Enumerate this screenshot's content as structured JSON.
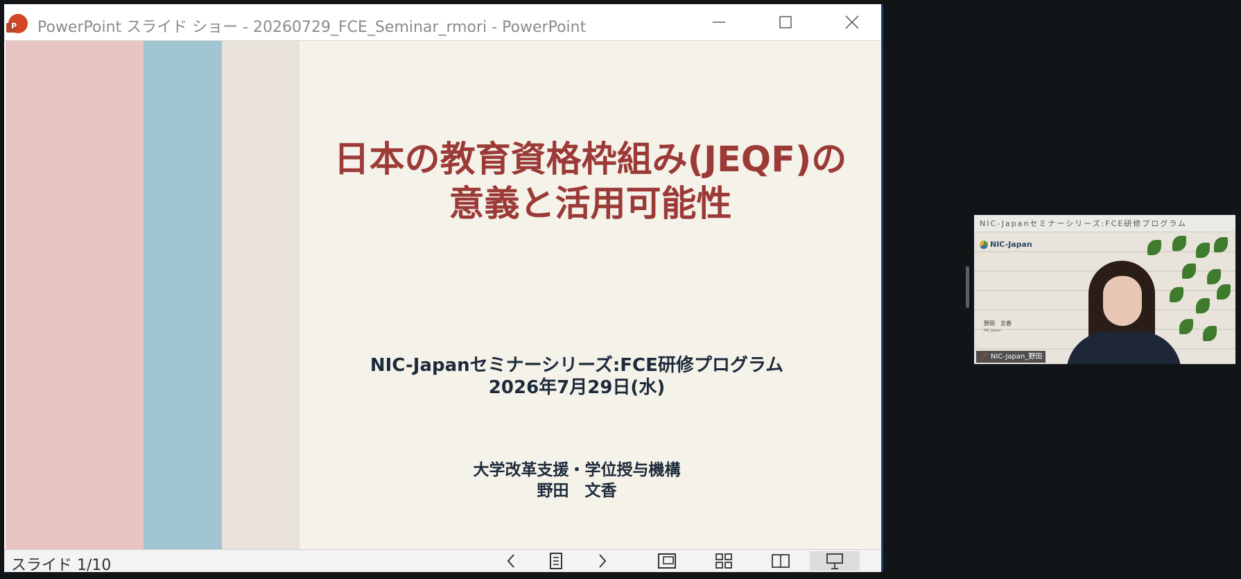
{
  "window": {
    "title": "PowerPoint スライド ショー  -  20260729_FCE_Seminar_rmori - PowerPoint",
    "app_icon": "powerpoint-icon",
    "controls": [
      "minimize-icon",
      "maximize-icon",
      "close-icon"
    ]
  },
  "slide": {
    "title_line1": "日本の教育資格枠組み(JEQF)の",
    "title_line2": "意義と活用可能性",
    "series": "NIC-Japanセミナーシリーズ:FCE研修プログラム",
    "date": "2026年7月29日(水)",
    "organization": "大学改革支援・学位授与機構",
    "presenter": "野田　文香",
    "colors": {
      "title": "#9b3a37",
      "band_pink": "#e8c5c3",
      "band_blue": "#a1c4d1",
      "band_beige": "#e8e2da",
      "background": "#f5f2ea"
    }
  },
  "statusbar": {
    "slide_counter": "スライド 1/10",
    "buttons": [
      "previous-slide-icon",
      "slide-list-icon",
      "next-slide-icon",
      "normal-view-icon",
      "slide-sorter-icon",
      "reading-view-icon",
      "slideshow-view-icon"
    ]
  },
  "webcam": {
    "banner": "NIC-Japanセミナーシリーズ:FCE研修プログラム",
    "logo": "NIC-Japan",
    "sign_name": "野田　文香",
    "sign_org": "NIC-Japan",
    "participant_label": "NIC-Japan_野田"
  }
}
